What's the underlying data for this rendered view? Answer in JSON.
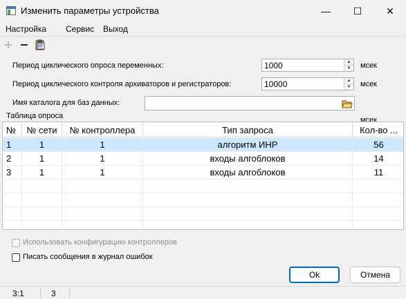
{
  "window": {
    "title": "Изменить параметры устройства",
    "controls": {
      "minimize": "—",
      "maximize": "☐",
      "close": "✕"
    }
  },
  "menu": [
    "Настройка",
    "Сервис",
    "Выход"
  ],
  "toolbar": {
    "icons": [
      "add-icon",
      "remove-icon",
      "clipboard-icon"
    ]
  },
  "form": {
    "poll_period": {
      "label": "Период циклического опроса переменных:",
      "value": "1000",
      "unit": "мсек"
    },
    "archive_period": {
      "label": "Период циклического контроля архиваторов и регистраторов:",
      "value": "10000",
      "unit": "мсек"
    },
    "db_dir": {
      "label": "Имя каталога для баз данных:",
      "value": ""
    }
  },
  "table": {
    "group_label": "Таблица опроса",
    "clipped_label": "мсек",
    "columns": [
      "№",
      "№ сети",
      "№ контроллера",
      "Тип запроса",
      "Кол-во ..."
    ],
    "rows": [
      {
        "num": "1",
        "network": "1",
        "controller": "1",
        "type": "алгоритм ИНР",
        "count": "56",
        "selected": true
      },
      {
        "num": "2",
        "network": "1",
        "controller": "1",
        "type": "входы алгоблоков",
        "count": "14",
        "selected": false
      },
      {
        "num": "3",
        "network": "1",
        "controller": "1",
        "type": "входы алгоблоков",
        "count": "11",
        "selected": false
      }
    ]
  },
  "options": {
    "use_config": {
      "label": "Использовать конфигурацию контроллеров",
      "checked": false,
      "disabled": true
    },
    "log_errors": {
      "label": "Писать сообщения в журнал ошибок",
      "checked": false,
      "disabled": false
    }
  },
  "buttons": {
    "ok": "Ok",
    "cancel": "Отмена"
  },
  "status": {
    "position": "3:1",
    "count": "3"
  },
  "colors": {
    "selection": "#cce8ff",
    "accent": "#0067c0"
  }
}
